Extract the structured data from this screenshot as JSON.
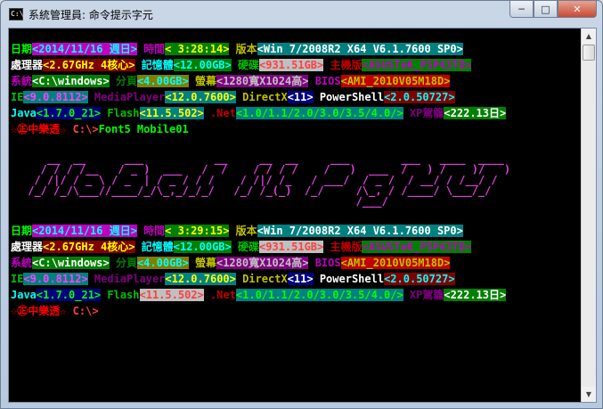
{
  "window": {
    "icon_label": "C:\\",
    "title": "系統管理員: 命令提示字元",
    "controls": {
      "minimize": "─",
      "maximize": "□",
      "close": "✕"
    }
  },
  "scrollbar": {
    "up": "▲",
    "down": "▼"
  },
  "colors": {
    "background": "#000000",
    "green": "#00c000",
    "bright_green": "#00ff00",
    "magenta": "#c000c0",
    "yellow": "#c0c000",
    "cyan": "#00ffff",
    "red": "#c00000",
    "bright_red": "#ff4040",
    "white": "#ffffff"
  },
  "block1": [
    [
      {
        "t": "日期",
        "fg": "#00ff00",
        "bg": ""
      },
      {
        "t": "<2014/11/16 週日>",
        "fg": "#00ffff",
        "bg": "#c000c0"
      },
      {
        "t": " 時間",
        "fg": "#c000c0",
        "bg": ""
      },
      {
        "t": "< 3:28:14>",
        "fg": "#ffff00",
        "bg": "#008000"
      },
      {
        "t": " 版本",
        "fg": "#c0c000",
        "bg": ""
      },
      {
        "t": "<Win 7/2008R2 X64 V6.1.7600 SP0>",
        "fg": "#ffffff",
        "bg": "#008080"
      }
    ],
    [
      {
        "t": "處理器",
        "fg": "#ffffff",
        "bg": ""
      },
      {
        "t": "<2.67GHz 4核心>",
        "fg": "#ffff00",
        "bg": "#800000"
      },
      {
        "t": " 記憶體",
        "fg": "#00ffff",
        "bg": ""
      },
      {
        "t": "<12.00GB>",
        "fg": "#00ffff",
        "bg": "#008000"
      },
      {
        "t": " 硬碟",
        "fg": "#00c000",
        "bg": ""
      },
      {
        "t": "<931.51GB>",
        "fg": "#ff4040",
        "bg": "#c0c0c0"
      },
      {
        "t": " 主機版",
        "fg": "#c00000",
        "bg": ""
      },
      {
        "t": "<ASUSTeK_P5P43TD>",
        "fg": "#c000c0",
        "bg": "#008000"
      }
    ],
    [
      {
        "t": "系統",
        "fg": "#c000c0",
        "bg": ""
      },
      {
        "t": "<C:\\windows>",
        "fg": "#ffffff",
        "bg": "#008000"
      },
      {
        "t": " 分頁",
        "fg": "#008000",
        "bg": ""
      },
      {
        "t": "<4.00GB>",
        "fg": "#00ffff",
        "bg": "#808000"
      },
      {
        "t": " 螢幕",
        "fg": "#c0c000",
        "bg": ""
      },
      {
        "t": "<1280寬X1024高>",
        "fg": "#c0c0c0",
        "bg": "#800080"
      },
      {
        "t": " BIOS",
        "fg": "#c000c0",
        "bg": ""
      },
      {
        "t": "<AMI_2010V05M18D>",
        "fg": "#c0c000",
        "bg": "#c00000"
      }
    ],
    [
      {
        "t": "IE",
        "fg": "#00c000",
        "bg": ""
      },
      {
        "t": "<9.0.8112>",
        "fg": "#ff40ff",
        "bg": "#008080"
      },
      {
        "t": " MediaPlayer",
        "fg": "#800080",
        "bg": ""
      },
      {
        "t": "<12.0.7600>",
        "fg": "#ffff00",
        "bg": "#008080"
      },
      {
        "t": " DirectX",
        "fg": "#c0c000",
        "bg": ""
      },
      {
        "t": "<11>",
        "fg": "#ffffff",
        "bg": "#000080"
      },
      {
        "t": " PowerShell",
        "fg": "#ffffff",
        "bg": ""
      },
      {
        "t": "<2.0.50727>",
        "fg": "#00ffff",
        "bg": "#800000"
      }
    ],
    [
      {
        "t": "Java",
        "fg": "#00ffff",
        "bg": ""
      },
      {
        "t": "<1.7.0_21>",
        "fg": "#00ff00",
        "bg": "#000080"
      },
      {
        "t": " Flash",
        "fg": "#00c000",
        "bg": ""
      },
      {
        "t": "<11.5.502>",
        "fg": "#ffff00",
        "bg": "#008080"
      },
      {
        "t": " .Net",
        "fg": "#c00000",
        "bg": ""
      },
      {
        "t": "<1.0/1.1/2.0/3.0/3.5/4.0/>",
        "fg": "#00ff00",
        "bg": "#008080"
      },
      {
        "t": " XP駕籠",
        "fg": "#800080",
        "bg": ""
      },
      {
        "t": "<222.13日>",
        "fg": "#ffffff",
        "bg": "#008000"
      }
    ],
    [
      {
        "t": "☆㊣中樂透☆",
        "fg": "#ff0000",
        "bg": ""
      },
      {
        "t": " C:\\>",
        "fg": "#ff4040",
        "bg": ""
      },
      {
        "t": "Font5 Mobile01",
        "fg": "#00ff00",
        "bg": ""
      }
    ]
  ],
  "banner_lines": [
    "    __  __      ___           __     __  __     ___        ___   ____  ____    ",
    "   / / / /__   / _ )  ___   /  /    / / / /    /   )  ___  /   ) /    )/   )   ",
    "  / /|/ / _ \\ / _  | / _ / / /    / /|/ /_   / ___/  / _ /  / __/ / /__/ /      ",
    " /_/ /_/\\___//____/_/\\_,_/_/_/   /_/ /_(_)  /_/     /\\_, / /____/ \\___/_/       ",
    "                                                    /___/                        "
  ],
  "block2": [
    [
      {
        "t": "日期",
        "fg": "#00ff00",
        "bg": ""
      },
      {
        "t": "<2014/11/16 週日>",
        "fg": "#00ffff",
        "bg": "#c000c0"
      },
      {
        "t": " 時間",
        "fg": "#c000c0",
        "bg": ""
      },
      {
        "t": "< 3:29:15>",
        "fg": "#ffff00",
        "bg": "#008000"
      },
      {
        "t": " 版本",
        "fg": "#c0c000",
        "bg": ""
      },
      {
        "t": "<Win 7/2008R2 X64 V6.1.7600 SP0>",
        "fg": "#ffffff",
        "bg": "#008080"
      }
    ],
    [
      {
        "t": "處理器",
        "fg": "#ffffff",
        "bg": ""
      },
      {
        "t": "<2.67GHz 4核心>",
        "fg": "#ffff00",
        "bg": "#800000"
      },
      {
        "t": " 記憶體",
        "fg": "#00ffff",
        "bg": ""
      },
      {
        "t": "<12.00GB>",
        "fg": "#00ffff",
        "bg": "#008000"
      },
      {
        "t": " 硬碟",
        "fg": "#00c000",
        "bg": ""
      },
      {
        "t": "<931.51GB>",
        "fg": "#ff4040",
        "bg": "#c0c0c0"
      },
      {
        "t": " 主機版",
        "fg": "#c00000",
        "bg": ""
      },
      {
        "t": "<ASUSTeK_P5P43TD>",
        "fg": "#c000c0",
        "bg": "#008000"
      }
    ],
    [
      {
        "t": "系統",
        "fg": "#c000c0",
        "bg": ""
      },
      {
        "t": "<C:\\windows>",
        "fg": "#ffffff",
        "bg": "#008000"
      },
      {
        "t": " 分頁",
        "fg": "#008000",
        "bg": ""
      },
      {
        "t": "<4.00GB>",
        "fg": "#00ffff",
        "bg": "#808000"
      },
      {
        "t": " 螢幕",
        "fg": "#c0c000",
        "bg": ""
      },
      {
        "t": "<1280寬X1024高>",
        "fg": "#c0c0c0",
        "bg": "#800080"
      },
      {
        "t": " BIOS",
        "fg": "#c000c0",
        "bg": ""
      },
      {
        "t": "<AMI_2010V05M18D>",
        "fg": "#c0c000",
        "bg": "#c00000"
      }
    ],
    [
      {
        "t": "IE",
        "fg": "#00c000",
        "bg": ""
      },
      {
        "t": "<9.0.8112>",
        "fg": "#ff40ff",
        "bg": "#008080"
      },
      {
        "t": " MediaPlayer",
        "fg": "#800080",
        "bg": ""
      },
      {
        "t": "<12.0.7600>",
        "fg": "#ffff00",
        "bg": "#008080"
      },
      {
        "t": " DirectX",
        "fg": "#c0c000",
        "bg": ""
      },
      {
        "t": "<11>",
        "fg": "#ffffff",
        "bg": "#000080"
      },
      {
        "t": " PowerShell",
        "fg": "#ffffff",
        "bg": ""
      },
      {
        "t": "<2.0.50727>",
        "fg": "#00ffff",
        "bg": "#800000"
      }
    ],
    [
      {
        "t": "Java",
        "fg": "#00ffff",
        "bg": ""
      },
      {
        "t": "<1.7.0_21>",
        "fg": "#00ff00",
        "bg": "#000080"
      },
      {
        "t": " Flash",
        "fg": "#00c000",
        "bg": ""
      },
      {
        "t": "<11.5.502>",
        "fg": "#ff4040",
        "bg": "#c0c0c0"
      },
      {
        "t": " .Net",
        "fg": "#c00000",
        "bg": ""
      },
      {
        "t": "<1.0/1.1/2.0/3.0/3.5/4.0/>",
        "fg": "#00ff00",
        "bg": "#008080"
      },
      {
        "t": " XP駕籠",
        "fg": "#800080",
        "bg": ""
      },
      {
        "t": "<222.13日>",
        "fg": "#ffffff",
        "bg": "#008000"
      }
    ],
    [
      {
        "t": "☆㊣中樂透☆",
        "fg": "#ff0000",
        "bg": ""
      },
      {
        "t": " C:\\>",
        "fg": "#ff4040",
        "bg": ""
      }
    ]
  ]
}
